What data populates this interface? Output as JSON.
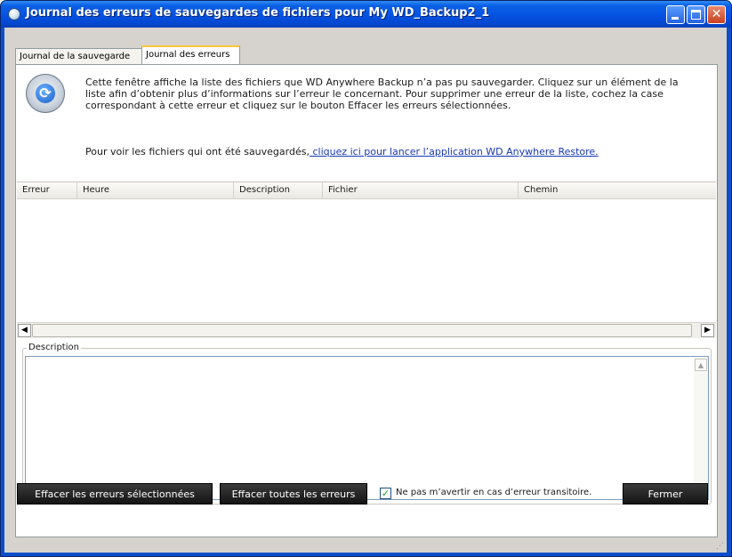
{
  "window": {
    "title": "Journal des erreurs de sauvegardes de fichiers pour My WD_Backup2_1",
    "app_icon": "wd-backup-icon",
    "controls": {
      "minimize": "minimize-icon",
      "maximize": "maximize-icon",
      "close": "close-icon",
      "close_glyph": "✕"
    }
  },
  "tabs": [
    {
      "label": "Journal de la sauvegarde",
      "active": false
    },
    {
      "label": "Journal des erreurs",
      "active": true
    }
  ],
  "intro": {
    "icon": "backup-clock-icon",
    "text": "Cette fenêtre affiche la liste des fichiers que WD Anywhere Backup n’a pas pu sauvegarder. Cliquez sur un élément de la liste afin d’obtenir plus d’informations sur l’erreur le concernant. Pour supprimer une erreur de la liste, cochez la case correspondant à cette erreur et cliquez sur le bouton Effacer les erreurs sélectionnées.",
    "see_prefix": "Pour voir les fichiers qui ont été sauvegardés,",
    "see_link": " cliquez ici pour lancer l’application WD Anywhere Restore."
  },
  "table": {
    "columns": [
      "Erreur",
      "Heure",
      "Description",
      "Fichier",
      "Chemin"
    ],
    "rows": []
  },
  "scrollbar": {
    "left": "◀",
    "right": "▶",
    "up": "▲",
    "down": "▼"
  },
  "description": {
    "legend": "Description",
    "value": ""
  },
  "footer": {
    "clear_selected_label": "Effacer les erreurs sélectionnées",
    "clear_all_label": "Effacer toutes les erreurs",
    "checkbox_label": "Ne pas m’avertir en cas d’erreur transitoire.",
    "checkbox_checked": true,
    "checkbox_glyph": "✓",
    "close_label": "Fermer",
    "grip": "⋰"
  },
  "colors": {
    "titlebar": "#0554e3",
    "button_dark": "#1e1e1e",
    "link": "#1638b5",
    "tab_active_accent": "#ffc73c"
  }
}
